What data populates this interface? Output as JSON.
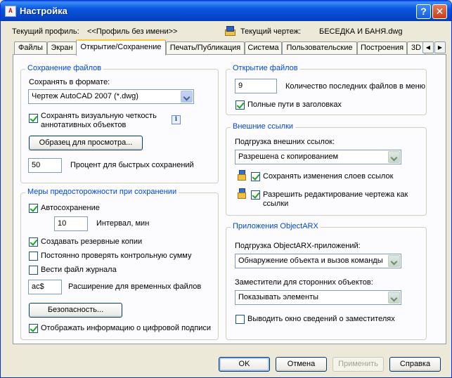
{
  "window": {
    "title": "Настройка",
    "help_glyph": "?",
    "close_glyph": "✕",
    "app_icon_glyph": "A"
  },
  "header": {
    "profile_label": "Текущий профиль:",
    "profile_value": "<<Профиль без имени>>",
    "drawing_label": "Текущий чертеж:",
    "drawing_value": "БЕСЕДКА И БАНЯ.dwg"
  },
  "tabs": [
    {
      "label": "Файлы"
    },
    {
      "label": "Экран"
    },
    {
      "label": "Открытие/Сохранение"
    },
    {
      "label": "Печать/Публикация"
    },
    {
      "label": "Система"
    },
    {
      "label": "Пользовательские"
    },
    {
      "label": "Построения"
    },
    {
      "label": "3D"
    }
  ],
  "active_tab": "Открытие/Сохранение",
  "tab_scroll": {
    "left": "◀",
    "right": "▶"
  },
  "save_files": {
    "title": "Сохранение файлов",
    "format_label": "Сохранять в формате:",
    "format_value": "Чертеж AutoCAD 2007 (*.dwg)",
    "keep_visual_fidelity": "Сохранять визуальную четкость аннотативных объектов",
    "keep_visual_fidelity_checked": true,
    "info_glyph": "i",
    "thumbnail_button": "Образец для просмотра...",
    "incremental_value": "50",
    "incremental_label": "Процент для быстрых сохранений"
  },
  "safety": {
    "title": "Меры предосторожности при сохранении",
    "autosave": "Автосохранение",
    "autosave_checked": true,
    "interval_value": "10",
    "interval_label": "Интервал, мин",
    "backup": "Создавать резервные копии",
    "backup_checked": true,
    "crc": "Постоянно проверять контрольную сумму",
    "crc_checked": false,
    "log": "Вести файл журнала",
    "log_checked": false,
    "ext_value": "ac$",
    "ext_label": "Расширение для временных файлов",
    "security_button": "Безопасность...",
    "digital_sig": "Отображать информацию о цифровой подписи",
    "digital_sig_checked": true
  },
  "file_open": {
    "title": "Открытие файлов",
    "recent_value": "9",
    "recent_label": "Количество последних файлов в меню",
    "full_path": "Полные пути в заголовках",
    "full_path_checked": true
  },
  "xrefs": {
    "title": "Внешние ссылки",
    "demand_label": "Подгрузка внешних ссылок:",
    "demand_value": "Разрешена с копированием",
    "retain_layers": "Сохранять изменения слоев ссылок",
    "retain_layers_checked": true,
    "allow_edit": "Разрешить редактирование чертежа как ссылки",
    "allow_edit_checked": true
  },
  "objectarx": {
    "title": "Приложения ObjectARX",
    "demand_label": "Подгрузка ObjectARX-приложений:",
    "demand_value": "Обнаружение объекта и вызов команды",
    "proxy_label": "Заместители для сторонних объектов:",
    "proxy_value": "Показывать элементы",
    "proxy_info": "Выводить окно сведений о заместителях",
    "proxy_info_checked": false
  },
  "footer": {
    "ok": "OK",
    "cancel": "Отмена",
    "apply": "Применить",
    "help": "Справка"
  }
}
